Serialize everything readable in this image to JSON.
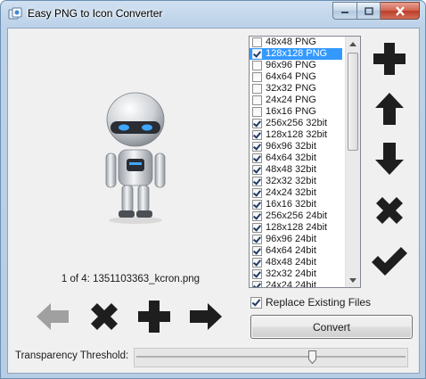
{
  "window": {
    "title": "Easy PNG to Icon Converter"
  },
  "preview": {
    "file_label": "1 of 4: 1351103363_kcron.png"
  },
  "formats": [
    {
      "label": "48x48 PNG",
      "checked": false,
      "selected": false
    },
    {
      "label": "128x128 PNG",
      "checked": true,
      "selected": true
    },
    {
      "label": "96x96 PNG",
      "checked": false,
      "selected": false
    },
    {
      "label": "64x64 PNG",
      "checked": false,
      "selected": false
    },
    {
      "label": "32x32 PNG",
      "checked": false,
      "selected": false
    },
    {
      "label": "24x24 PNG",
      "checked": false,
      "selected": false
    },
    {
      "label": "16x16 PNG",
      "checked": false,
      "selected": false
    },
    {
      "label": "256x256 32bit",
      "checked": true,
      "selected": false
    },
    {
      "label": "128x128 32bit",
      "checked": true,
      "selected": false
    },
    {
      "label": "96x96 32bit",
      "checked": true,
      "selected": false
    },
    {
      "label": "64x64 32bit",
      "checked": true,
      "selected": false
    },
    {
      "label": "48x48 32bit",
      "checked": true,
      "selected": false
    },
    {
      "label": "32x32 32bit",
      "checked": true,
      "selected": false
    },
    {
      "label": "24x24 32bit",
      "checked": true,
      "selected": false
    },
    {
      "label": "16x16 32bit",
      "checked": true,
      "selected": false
    },
    {
      "label": "256x256 24bit",
      "checked": true,
      "selected": false
    },
    {
      "label": "128x128 24bit",
      "checked": true,
      "selected": false
    },
    {
      "label": "96x96 24bit",
      "checked": true,
      "selected": false
    },
    {
      "label": "64x64 24bit",
      "checked": true,
      "selected": false
    },
    {
      "label": "48x48 24bit",
      "checked": true,
      "selected": false
    },
    {
      "label": "32x32 24bit",
      "checked": true,
      "selected": false
    },
    {
      "label": "24x24 24bit",
      "checked": true,
      "selected": false
    }
  ],
  "options": {
    "replace_label": "Replace Existing Files",
    "replace_checked": true
  },
  "convert": {
    "label": "Convert"
  },
  "threshold": {
    "label": "Transparency Threshold:",
    "value_fraction": 0.66
  },
  "icons": {
    "app": "app-icon",
    "add": "plus-icon",
    "up": "arrow-up-icon",
    "down": "arrow-down-icon",
    "remove": "x-icon",
    "apply": "checkmark-icon",
    "prev": "arrow-left-icon",
    "next": "arrow-right-icon"
  },
  "colors": {
    "icon_dark": "#1e1e1e",
    "icon_disabled": "#a0a0a0",
    "selection": "#3399ff"
  }
}
